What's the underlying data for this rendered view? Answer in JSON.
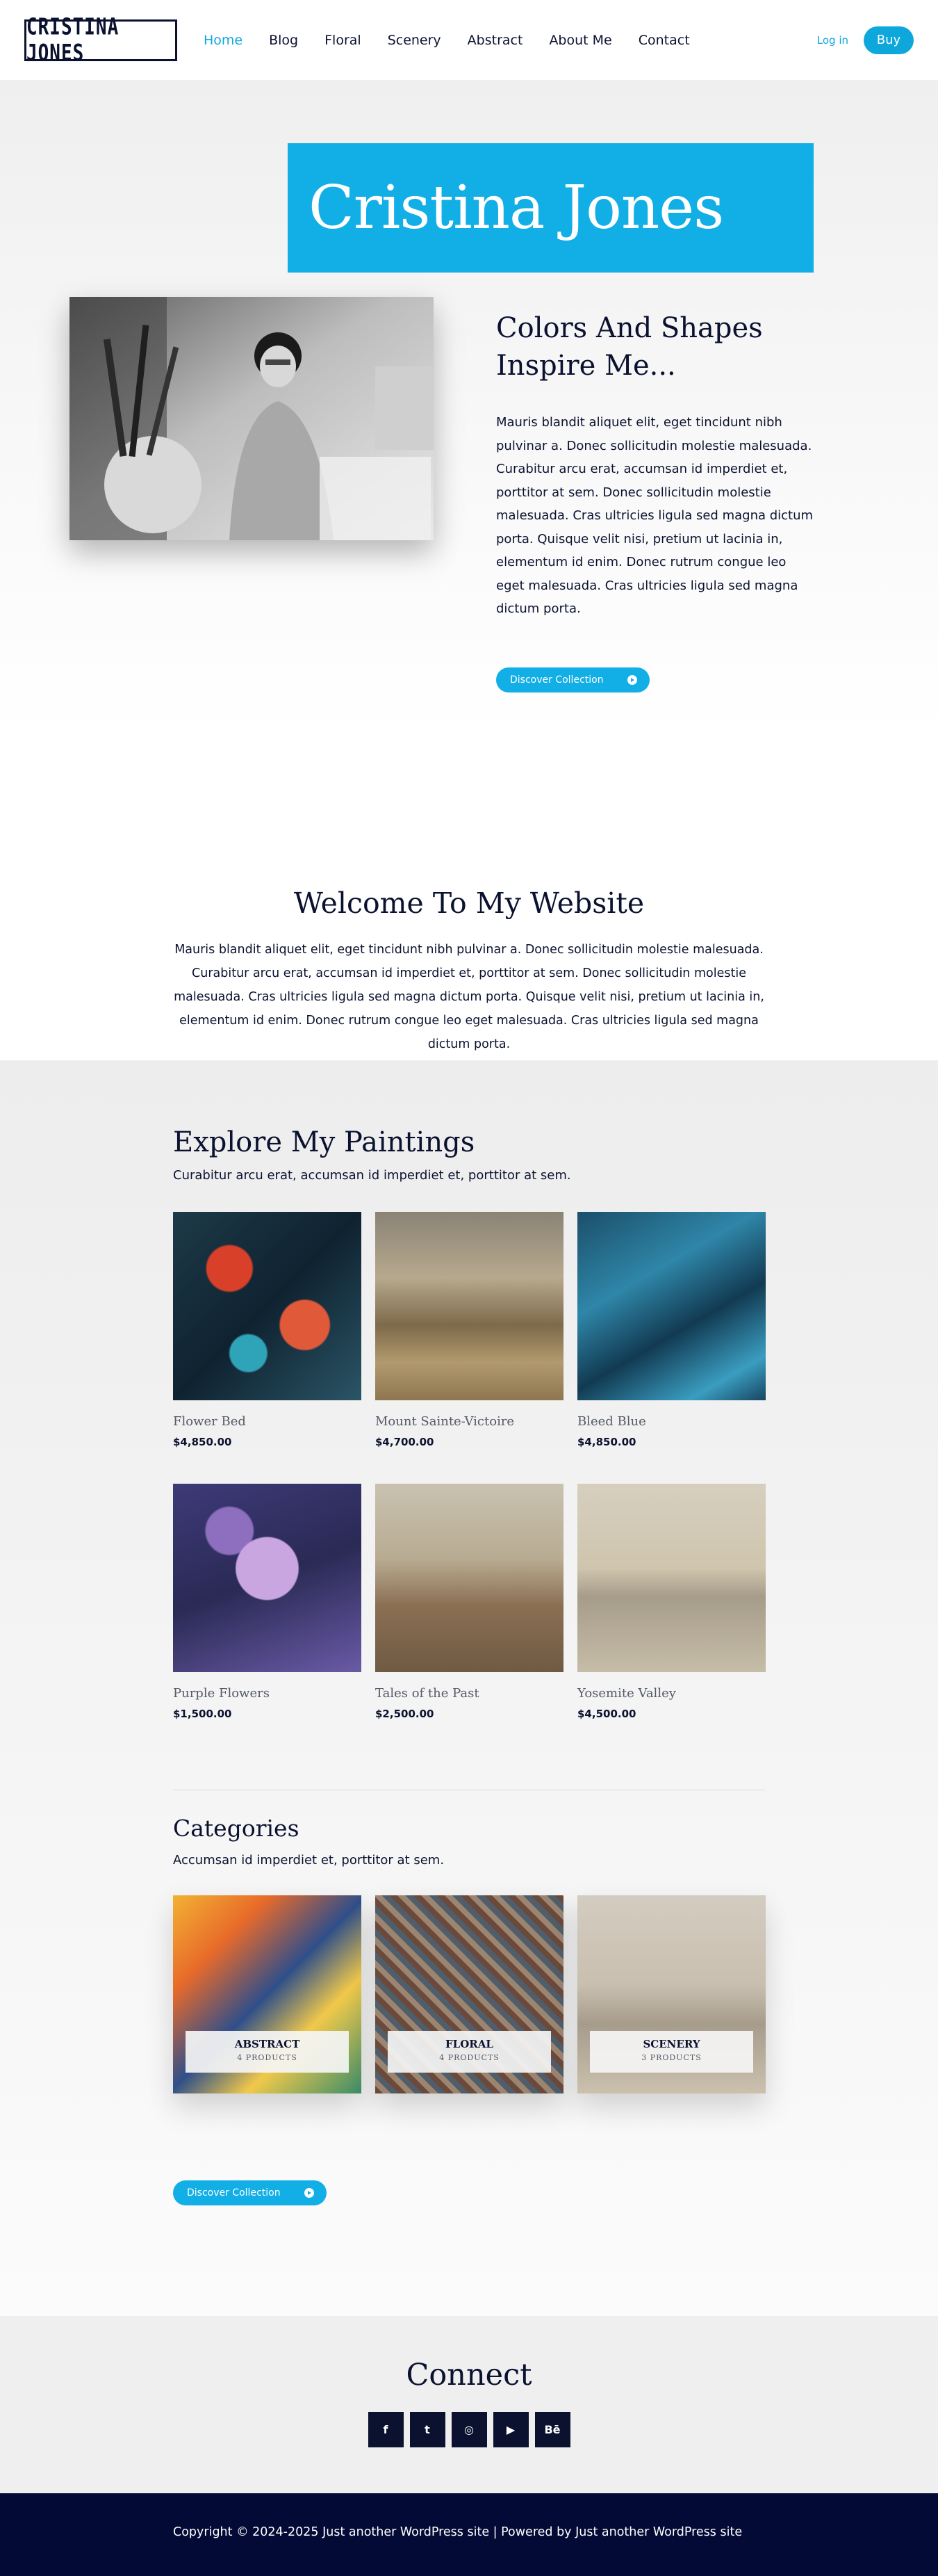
{
  "header": {
    "logo_text": "CRISTINA JONES",
    "nav": [
      "Home",
      "Blog",
      "Floral",
      "Scenery",
      "Abstract",
      "About Me",
      "Contact"
    ],
    "login_label": "Log in",
    "buy_label": "Buy"
  },
  "hero": {
    "name": "Cristina Jones",
    "heading": "Colors And Shapes Inspire Me...",
    "body": "Mauris blandit aliquet elit, eget tincidunt nibh pulvinar a. Donec sollicitudin molestie malesuada. Curabitur arcu erat, accumsan id imperdiet et, porttitor at sem. Donec sollicitudin molestie malesuada. Cras ultricies ligula sed magna dictum porta. Quisque velit nisi, pretium ut lacinia in, elementum id enim. Donec rutrum congue leo eget malesuada. Cras ultricies ligula sed magna dictum porta.",
    "button_label": "Discover Collection"
  },
  "welcome": {
    "title": "Welcome To My Website",
    "body": "Mauris blandit aliquet elit, eget tincidunt nibh pulvinar a. Donec sollicitudin molestie malesuada. Curabitur arcu erat, accumsan id imperdiet et, porttitor at sem. Donec sollicitudin molestie malesuada. Cras ultricies ligula sed magna dictum porta. Quisque velit nisi, pretium ut lacinia in, elementum id enim. Donec rutrum congue leo eget malesuada. Cras ultricies ligula sed magna dictum porta."
  },
  "explore": {
    "title": "Explore My Paintings",
    "subtitle": "Curabitur arcu erat, accumsan id imperdiet et, porttitor at sem.",
    "products": [
      {
        "title": "Flower Bed",
        "price": "$4,850.00"
      },
      {
        "title": "Mount Sainte-Victoire",
        "price": "$4,700.00"
      },
      {
        "title": "Bleed Blue",
        "price": "$4,850.00"
      },
      {
        "title": "Purple Flowers",
        "price": "$1,500.00"
      },
      {
        "title": "Tales of the Past",
        "price": "$2,500.00"
      },
      {
        "title": "Yosemite Valley",
        "price": "$4,500.00"
      }
    ]
  },
  "categories": {
    "title": "Categories",
    "subtitle": "Accumsan id imperdiet et, porttitor at sem.",
    "items": [
      {
        "name": "ABSTRACT",
        "count": "4 PRODUCTS"
      },
      {
        "name": "FLORAL",
        "count": "4 PRODUCTS"
      },
      {
        "name": "SCENERY",
        "count": "3 PRODUCTS"
      }
    ],
    "button_label": "Discover Collection"
  },
  "connect": {
    "title": "Connect",
    "socials": [
      {
        "icon": "facebook-icon",
        "glyph": "f"
      },
      {
        "icon": "twitter-icon",
        "glyph": "t"
      },
      {
        "icon": "instagram-icon",
        "glyph": "◎"
      },
      {
        "icon": "youtube-icon",
        "glyph": "▶"
      },
      {
        "icon": "behance-icon",
        "glyph": "Bē"
      }
    ]
  },
  "footer": {
    "text": "Copyright © 2024-2025 Just another WordPress site | Powered by Just another WordPress site"
  },
  "colors": {
    "accent": "#12aee6",
    "navy": "#0b1230",
    "footer_bg": "#030a35"
  }
}
